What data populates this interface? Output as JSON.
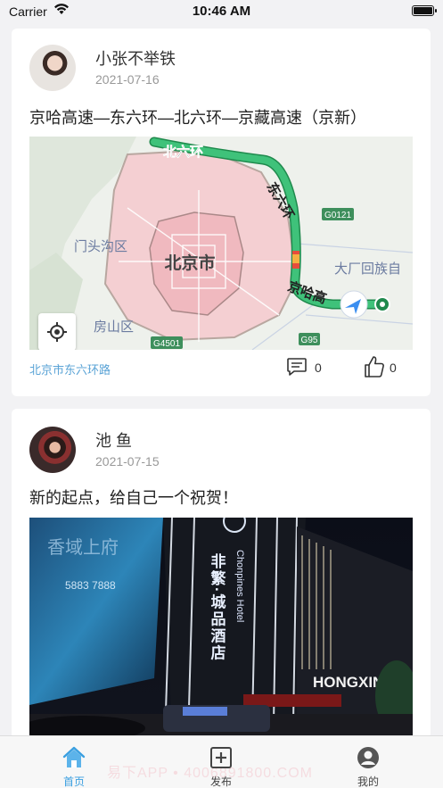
{
  "status_bar": {
    "carrier": "Carrier",
    "time": "10:46 AM"
  },
  "posts": [
    {
      "username": "小张不举铁",
      "date": "2021-07-16",
      "content": "京哈高速—东六环—北六环—京藏高速（京新）",
      "location": "北京市东六环路",
      "comments": "0",
      "likes": "0",
      "map": {
        "city_label": "北京市",
        "districts": [
          "门头沟区",
          "房山区",
          "大厂回族自"
        ],
        "road_labels": [
          "北六环",
          "东六环",
          "京哈高"
        ],
        "shields": [
          "G0121",
          "G4501",
          "G95"
        ],
        "colors": {
          "route": "#2fb36a",
          "beijing_area": "#f3c9cd",
          "congestion": "#e74c3c",
          "nav_arrow": "#3b8ef0"
        }
      }
    },
    {
      "username": "池 鱼",
      "date": "2021-07-15",
      "content": "新的起点，给自己一个祝贺！",
      "photo": {
        "sign_vertical": "非繁·城品酒店",
        "sign_english": "Chonpines Hotel",
        "sign_right": "HONGXIN",
        "billboard_phone": "5883 7888"
      }
    }
  ],
  "tabbar": {
    "tabs": [
      {
        "label": "首页",
        "icon": "home-icon",
        "active": true
      },
      {
        "label": "发布",
        "icon": "plus-square-icon",
        "active": false
      },
      {
        "label": "我的",
        "icon": "user-circle-icon",
        "active": false
      }
    ],
    "watermark": "易下APP • 4006891800.COM",
    "accent": "#3a9fe0"
  }
}
